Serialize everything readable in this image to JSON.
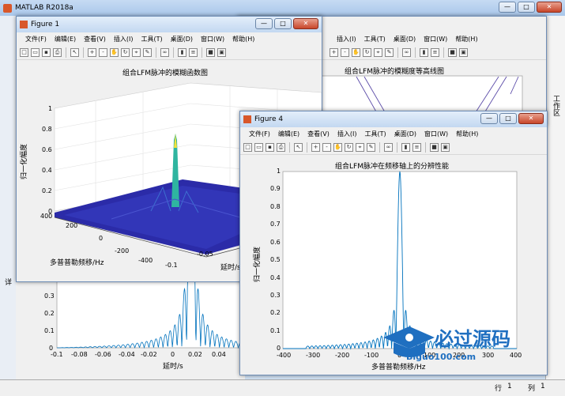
{
  "app": {
    "title": "MATLAB R2018a"
  },
  "menu": [
    "文件(F)",
    "编辑(E)",
    "查看(V)",
    "插入(I)",
    "工具(T)",
    "桌面(D)",
    "窗口(W)",
    "帮助(H)"
  ],
  "side": {
    "tab_label": "工作区",
    "left_label": "详"
  },
  "status": {
    "row_label": "行",
    "row_value": "1",
    "col_label": "列",
    "col_value": "1"
  },
  "fig1": {
    "title": "Figure 1",
    "plot_title": "组合LFM脉冲的模糊函数图",
    "zlabel": "归一化幅度",
    "ylabel": "多普普勒频移/Hz",
    "xlabel": "延时/s",
    "zticks": [
      "1",
      "0.8",
      "0.6",
      "0.4",
      "0.2",
      "0"
    ],
    "yticks": [
      "400",
      "200",
      "0",
      "-200",
      "-400"
    ],
    "xticks": [
      "-0.1",
      "-0.05"
    ]
  },
  "fig2": {
    "plot_title": "组合LFM脉冲的模糊度等高线图"
  },
  "fig3": {
    "xlabel": "延时/s",
    "xticks": [
      "-0.1",
      "-0.08",
      "-0.06",
      "-0.04",
      "-0.02",
      "0",
      "0.02",
      "0.04"
    ],
    "yticks": [
      "0.3",
      "0.2",
      "0.1",
      "0"
    ]
  },
  "fig4": {
    "title": "Figure 4",
    "plot_title": "组合LFM脉冲在频移轴上的分辨性能",
    "ylabel": "归一化幅度",
    "xlabel": "多普普勒频移/Hz",
    "yticks": [
      "1",
      "0.9",
      "0.8",
      "0.7",
      "0.6",
      "0.5",
      "0.4",
      "0.3",
      "0.2",
      "0.1",
      "0"
    ],
    "xticks": [
      "-400",
      "-300",
      "-200",
      "-100",
      "0",
      "100",
      "200",
      "300",
      "400"
    ]
  },
  "watermark": {
    "text": "必过源码",
    "sub": "Biguo100.com"
  },
  "colors": {
    "line": "#0072bd",
    "surface": "#2b2ba8"
  }
}
